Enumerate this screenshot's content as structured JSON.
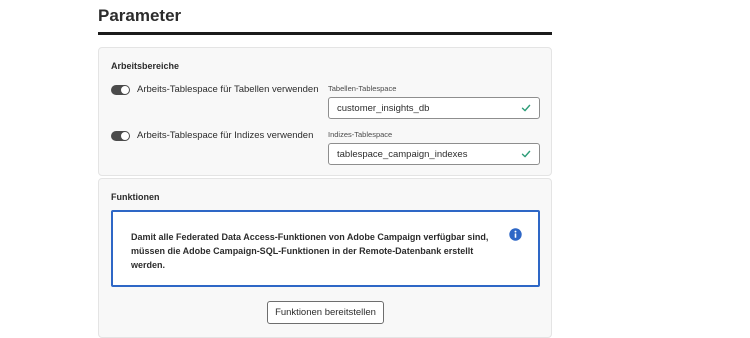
{
  "header": {
    "title": "Parameter"
  },
  "workspaces": {
    "section_title": "Arbeitsbereiche",
    "toggles": [
      {
        "label": "Arbeits-Tablespace für Tabellen verwenden",
        "checked": true
      },
      {
        "label": "Arbeits-Tablespace für Indizes verwenden",
        "checked": true
      }
    ],
    "fields": [
      {
        "label": "Tabellen-Tablespace",
        "value": "customer_insights_db",
        "valid": true
      },
      {
        "label": "Indizes-Tablespace",
        "value": "tablespace_campaign_indexes",
        "valid": true
      }
    ]
  },
  "functions": {
    "section_title": "Funktionen",
    "info_message": "Damit alle Federated Data Access-Funktionen von Adobe Campaign verfügbar sind, müssen die Adobe Campaign-SQL-Funktionen in der Remote-Datenbank erstellt werden.",
    "info_icon": "info-icon",
    "button_label": "Funktionen bereitstellen"
  },
  "colors": {
    "accent_blue": "#2e67c6",
    "valid_green": "#2d9d78",
    "toggle_on": "#4b4b4b"
  }
}
